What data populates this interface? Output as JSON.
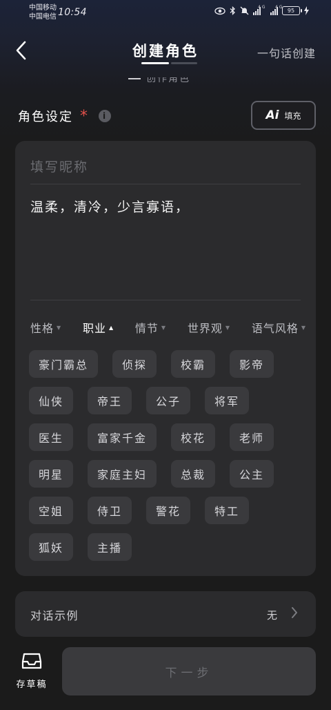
{
  "status_bar": {
    "carrier_1": "中国移动",
    "carrier_2": "中国电信",
    "time": "10:54",
    "network_1": "4G",
    "network_2": "4G",
    "battery": "95",
    "icons": [
      "eye-icon",
      "bluetooth-icon",
      "mute-icon",
      "signal-icon",
      "signal-icon",
      "battery-icon",
      "charging-icon"
    ]
  },
  "header": {
    "title": "创建角色",
    "right_action": "一句话创建",
    "subtitle_faded": "创作角色"
  },
  "role_settings": {
    "label": "角色设定",
    "required_mark": "*",
    "info_icon": "i",
    "ai_fill": {
      "logo": "Ai",
      "label": "填充"
    }
  },
  "name_field": {
    "placeholder": "填写昵称",
    "value": ""
  },
  "description": {
    "text": "温柔，清冷，少言寡语，"
  },
  "category_tabs": [
    {
      "label": "性格",
      "active": false
    },
    {
      "label": "职业",
      "active": true
    },
    {
      "label": "情节",
      "active": false
    },
    {
      "label": "世界观",
      "active": false
    },
    {
      "label": "语气风格",
      "active": false
    }
  ],
  "tags": [
    "豪门霸总",
    "侦探",
    "校霸",
    "影帝",
    "仙侠",
    "帝王",
    "公子",
    "将军",
    "医生",
    "富家千金",
    "校花",
    "老师",
    "明星",
    "家庭主妇",
    "总裁",
    "公主",
    "空姐",
    "侍卫",
    "警花",
    "特工",
    "狐妖",
    "主播"
  ],
  "dialog_example": {
    "label": "对话示例",
    "value": "无"
  },
  "bottom": {
    "draft_label": "存草稿",
    "next_label": "下一步"
  },
  "colors": {
    "accent_required": "#e2514a",
    "card_bg": "#2b2b2d",
    "tag_bg": "#3a3a3d",
    "page_bg": "#1b1b1b"
  }
}
